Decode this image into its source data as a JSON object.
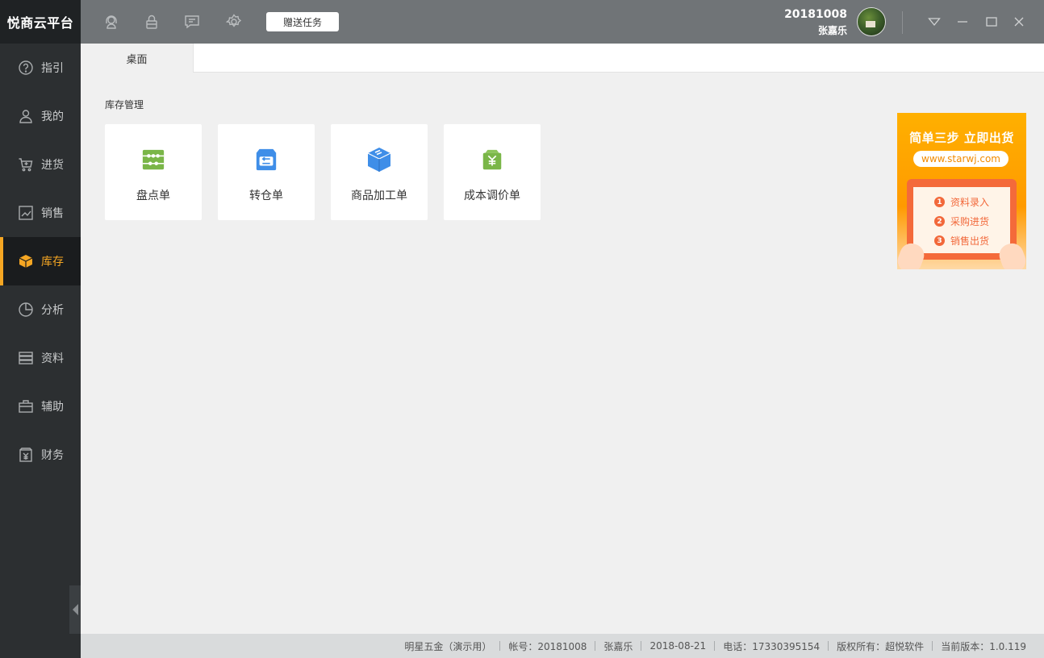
{
  "app": {
    "brand": "悦商云平台"
  },
  "sidebar": {
    "items": [
      {
        "label": "指引",
        "icon": "question-circle-icon"
      },
      {
        "label": "我的",
        "icon": "user-icon"
      },
      {
        "label": "进货",
        "icon": "cart-add-icon"
      },
      {
        "label": "销售",
        "icon": "chart-line-icon"
      },
      {
        "label": "库存",
        "icon": "box-icon",
        "active": true
      },
      {
        "label": "分析",
        "icon": "pie-chart-icon"
      },
      {
        "label": "资料",
        "icon": "database-icon"
      },
      {
        "label": "辅助",
        "icon": "toolbox-icon"
      },
      {
        "label": "财务",
        "icon": "yuan-icon"
      }
    ]
  },
  "topbar": {
    "icons": [
      "support-headset-icon",
      "lock-icon",
      "message-icon",
      "gear-icon"
    ],
    "gift_button": "赠送任务",
    "user_id": "20181008",
    "user_name": "张嘉乐"
  },
  "tabs": [
    {
      "label": "桌面"
    }
  ],
  "main": {
    "section_title": "库存管理",
    "cards": [
      {
        "label": "盘点单",
        "icon": "abacus-icon",
        "color": "#7ab648"
      },
      {
        "label": "转仓单",
        "icon": "transfer-icon",
        "color": "#3f8ee8"
      },
      {
        "label": "商品加工单",
        "icon": "package-icon",
        "color": "#3f8ee8"
      },
      {
        "label": "成本调价单",
        "icon": "price-tag-icon",
        "color": "#7ab648"
      }
    ]
  },
  "ad": {
    "title": "简单三步  立即出货",
    "url": "www.starwj.com",
    "steps": [
      {
        "num": "1",
        "text": "资料录入"
      },
      {
        "num": "2",
        "text": "采购进货"
      },
      {
        "num": "3",
        "text": "销售出货"
      }
    ]
  },
  "statusbar": {
    "company": "明星五金（演示用）",
    "account": "帐号：20181008",
    "user": "张嘉乐",
    "date": "2018-08-21",
    "phone": "电话：17330395154",
    "copyright": "版权所有：超悦软件",
    "version": "当前版本：1.0.119"
  },
  "colors": {
    "accent": "#f5a623",
    "sidebar": "#2c2f31",
    "topbar": "#707477"
  }
}
